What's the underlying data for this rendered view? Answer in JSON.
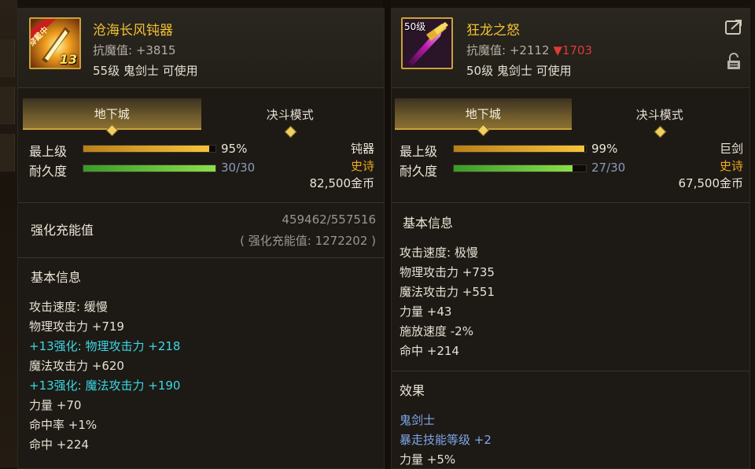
{
  "left_item": {
    "name": "沧海长风钝器",
    "resist": "抗魔值: +3815",
    "level_requirement": "55级 鬼剑士 可使用",
    "icon_badge": "穿戴中",
    "icon_enhance": "13",
    "tabs": [
      {
        "label": "地下城",
        "active": true
      },
      {
        "label": "决斗模式",
        "active": false
      }
    ],
    "highest_label": "最上级",
    "highest_value": "95%",
    "highest_fraction": 0.95,
    "durability_label": "耐久度",
    "durability_value": "30/30",
    "durability_fraction": 1.0,
    "weapon_type": "钝器",
    "rarity": "史诗",
    "price": "82,500金币",
    "reinforce": {
      "label": "强化充能值",
      "current": "459462/557516",
      "total": "( 强化充能值: 1272202 )"
    },
    "basic_title": "基本信息",
    "stats": [
      {
        "text": "攻击速度: 缓慢",
        "style": "normal"
      },
      {
        "text": "物理攻击力 +719",
        "style": "normal"
      },
      {
        "text": "+13强化: 物理攻击力 +218",
        "style": "cyan"
      },
      {
        "text": "魔法攻击力 +620",
        "style": "normal"
      },
      {
        "text": "+13强化: 魔法攻击力 +190",
        "style": "cyan"
      },
      {
        "text": "力量 +70",
        "style": "normal"
      },
      {
        "text": "命中率 +1%",
        "style": "normal"
      },
      {
        "text": "命中 +224",
        "style": "normal"
      }
    ]
  },
  "right_item": {
    "name": "狂龙之怒",
    "resist": "抗魔值: +2112",
    "resist_diff": "▼1703",
    "level_requirement": "50级 鬼剑士 可使用",
    "icon_level": "50级",
    "tabs": [
      {
        "label": "地下城",
        "active": true
      },
      {
        "label": "决斗模式",
        "active": false
      }
    ],
    "highest_label": "最上级",
    "highest_value": "99%",
    "highest_fraction": 0.99,
    "durability_label": "耐久度",
    "durability_value": "27/30",
    "durability_fraction": 0.9,
    "weapon_type": "巨剑",
    "rarity": "史诗",
    "price": "67,500金币",
    "basic_title": "基本信息",
    "stats": [
      {
        "text": "攻击速度: 极慢",
        "style": "normal"
      },
      {
        "text": "物理攻击力 +735",
        "style": "normal"
      },
      {
        "text": "魔法攻击力 +551",
        "style": "normal"
      },
      {
        "text": "力量 +43",
        "style": "normal"
      },
      {
        "text": "施放速度 -2%",
        "style": "normal"
      },
      {
        "text": "命中 +214",
        "style": "normal"
      }
    ],
    "effect_title": "效果",
    "effects": [
      {
        "text": "鬼剑士",
        "style": "blue"
      },
      {
        "text": "暴走技能等级 +2",
        "style": "blue"
      },
      {
        "text": "力量 +5%",
        "style": "normal"
      }
    ]
  },
  "colors": {
    "gold_name": "#f0c233",
    "epic": "#f0a820",
    "enhance_cyan": "#3ad8e6",
    "effect_blue": "#7fa6ea",
    "down_red": "#e03a3a"
  }
}
